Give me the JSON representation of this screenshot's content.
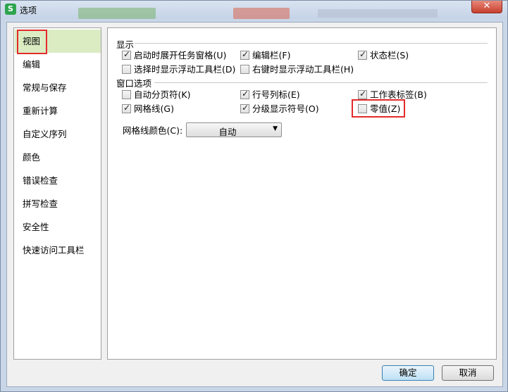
{
  "window": {
    "title": "选项",
    "app_icon": "S",
    "close_icon": "✕"
  },
  "sidebar": {
    "items": [
      {
        "label": "视图",
        "selected": true
      },
      {
        "label": "编辑"
      },
      {
        "label": "常规与保存"
      },
      {
        "label": "重新计算"
      },
      {
        "label": "自定义序列"
      },
      {
        "label": "颜色"
      },
      {
        "label": "错误检查"
      },
      {
        "label": "拼写检查"
      },
      {
        "label": "安全性"
      },
      {
        "label": "快速访问工具栏"
      }
    ]
  },
  "display": {
    "title": "显示",
    "options": [
      {
        "label": "启动时展开任务窗格(U)",
        "checked": true
      },
      {
        "label": "编辑栏(F)",
        "checked": true
      },
      {
        "label": "状态栏(S)",
        "checked": true
      },
      {
        "label": "选择时显示浮动工具栏(D)",
        "checked": false
      },
      {
        "label": "右键时显示浮动工具栏(H)",
        "checked": false
      }
    ]
  },
  "window_options": {
    "title": "窗口选项",
    "options": [
      {
        "label": "自动分页符(K)",
        "checked": false
      },
      {
        "label": "行号列标(E)",
        "checked": true
      },
      {
        "label": "工作表标签(B)",
        "checked": true
      },
      {
        "label": "网格线(G)",
        "checked": true
      },
      {
        "label": "分级显示符号(O)",
        "checked": true
      },
      {
        "label": "零值(Z)",
        "checked": false
      }
    ],
    "gridline_color": {
      "label": "网格线颜色(C):",
      "value": "自动"
    }
  },
  "buttons": {
    "ok": "确定",
    "cancel": "取消"
  },
  "colors": {
    "highlight_red": "#e32b2b",
    "selected_nav_bg": "#dbecc3"
  }
}
